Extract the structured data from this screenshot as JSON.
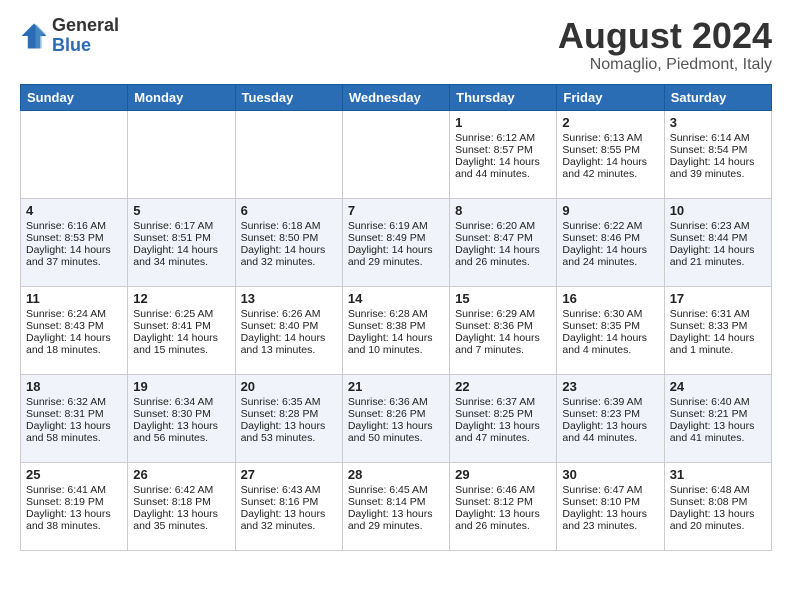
{
  "logo": {
    "general": "General",
    "blue": "Blue"
  },
  "title": "August 2024",
  "subtitle": "Nomaglio, Piedmont, Italy",
  "days": [
    "Sunday",
    "Monday",
    "Tuesday",
    "Wednesday",
    "Thursday",
    "Friday",
    "Saturday"
  ],
  "weeks": [
    [
      {
        "num": "",
        "sunrise": "",
        "sunset": "",
        "daylight": ""
      },
      {
        "num": "",
        "sunrise": "",
        "sunset": "",
        "daylight": ""
      },
      {
        "num": "",
        "sunrise": "",
        "sunset": "",
        "daylight": ""
      },
      {
        "num": "",
        "sunrise": "",
        "sunset": "",
        "daylight": ""
      },
      {
        "num": "1",
        "sunrise": "Sunrise: 6:12 AM",
        "sunset": "Sunset: 8:57 PM",
        "daylight": "Daylight: 14 hours and 44 minutes."
      },
      {
        "num": "2",
        "sunrise": "Sunrise: 6:13 AM",
        "sunset": "Sunset: 8:55 PM",
        "daylight": "Daylight: 14 hours and 42 minutes."
      },
      {
        "num": "3",
        "sunrise": "Sunrise: 6:14 AM",
        "sunset": "Sunset: 8:54 PM",
        "daylight": "Daylight: 14 hours and 39 minutes."
      }
    ],
    [
      {
        "num": "4",
        "sunrise": "Sunrise: 6:16 AM",
        "sunset": "Sunset: 8:53 PM",
        "daylight": "Daylight: 14 hours and 37 minutes."
      },
      {
        "num": "5",
        "sunrise": "Sunrise: 6:17 AM",
        "sunset": "Sunset: 8:51 PM",
        "daylight": "Daylight: 14 hours and 34 minutes."
      },
      {
        "num": "6",
        "sunrise": "Sunrise: 6:18 AM",
        "sunset": "Sunset: 8:50 PM",
        "daylight": "Daylight: 14 hours and 32 minutes."
      },
      {
        "num": "7",
        "sunrise": "Sunrise: 6:19 AM",
        "sunset": "Sunset: 8:49 PM",
        "daylight": "Daylight: 14 hours and 29 minutes."
      },
      {
        "num": "8",
        "sunrise": "Sunrise: 6:20 AM",
        "sunset": "Sunset: 8:47 PM",
        "daylight": "Daylight: 14 hours and 26 minutes."
      },
      {
        "num": "9",
        "sunrise": "Sunrise: 6:22 AM",
        "sunset": "Sunset: 8:46 PM",
        "daylight": "Daylight: 14 hours and 24 minutes."
      },
      {
        "num": "10",
        "sunrise": "Sunrise: 6:23 AM",
        "sunset": "Sunset: 8:44 PM",
        "daylight": "Daylight: 14 hours and 21 minutes."
      }
    ],
    [
      {
        "num": "11",
        "sunrise": "Sunrise: 6:24 AM",
        "sunset": "Sunset: 8:43 PM",
        "daylight": "Daylight: 14 hours and 18 minutes."
      },
      {
        "num": "12",
        "sunrise": "Sunrise: 6:25 AM",
        "sunset": "Sunset: 8:41 PM",
        "daylight": "Daylight: 14 hours and 15 minutes."
      },
      {
        "num": "13",
        "sunrise": "Sunrise: 6:26 AM",
        "sunset": "Sunset: 8:40 PM",
        "daylight": "Daylight: 14 hours and 13 minutes."
      },
      {
        "num": "14",
        "sunrise": "Sunrise: 6:28 AM",
        "sunset": "Sunset: 8:38 PM",
        "daylight": "Daylight: 14 hours and 10 minutes."
      },
      {
        "num": "15",
        "sunrise": "Sunrise: 6:29 AM",
        "sunset": "Sunset: 8:36 PM",
        "daylight": "Daylight: 14 hours and 7 minutes."
      },
      {
        "num": "16",
        "sunrise": "Sunrise: 6:30 AM",
        "sunset": "Sunset: 8:35 PM",
        "daylight": "Daylight: 14 hours and 4 minutes."
      },
      {
        "num": "17",
        "sunrise": "Sunrise: 6:31 AM",
        "sunset": "Sunset: 8:33 PM",
        "daylight": "Daylight: 14 hours and 1 minute."
      }
    ],
    [
      {
        "num": "18",
        "sunrise": "Sunrise: 6:32 AM",
        "sunset": "Sunset: 8:31 PM",
        "daylight": "Daylight: 13 hours and 58 minutes."
      },
      {
        "num": "19",
        "sunrise": "Sunrise: 6:34 AM",
        "sunset": "Sunset: 8:30 PM",
        "daylight": "Daylight: 13 hours and 56 minutes."
      },
      {
        "num": "20",
        "sunrise": "Sunrise: 6:35 AM",
        "sunset": "Sunset: 8:28 PM",
        "daylight": "Daylight: 13 hours and 53 minutes."
      },
      {
        "num": "21",
        "sunrise": "Sunrise: 6:36 AM",
        "sunset": "Sunset: 8:26 PM",
        "daylight": "Daylight: 13 hours and 50 minutes."
      },
      {
        "num": "22",
        "sunrise": "Sunrise: 6:37 AM",
        "sunset": "Sunset: 8:25 PM",
        "daylight": "Daylight: 13 hours and 47 minutes."
      },
      {
        "num": "23",
        "sunrise": "Sunrise: 6:39 AM",
        "sunset": "Sunset: 8:23 PM",
        "daylight": "Daylight: 13 hours and 44 minutes."
      },
      {
        "num": "24",
        "sunrise": "Sunrise: 6:40 AM",
        "sunset": "Sunset: 8:21 PM",
        "daylight": "Daylight: 13 hours and 41 minutes."
      }
    ],
    [
      {
        "num": "25",
        "sunrise": "Sunrise: 6:41 AM",
        "sunset": "Sunset: 8:19 PM",
        "daylight": "Daylight: 13 hours and 38 minutes."
      },
      {
        "num": "26",
        "sunrise": "Sunrise: 6:42 AM",
        "sunset": "Sunset: 8:18 PM",
        "daylight": "Daylight: 13 hours and 35 minutes."
      },
      {
        "num": "27",
        "sunrise": "Sunrise: 6:43 AM",
        "sunset": "Sunset: 8:16 PM",
        "daylight": "Daylight: 13 hours and 32 minutes."
      },
      {
        "num": "28",
        "sunrise": "Sunrise: 6:45 AM",
        "sunset": "Sunset: 8:14 PM",
        "daylight": "Daylight: 13 hours and 29 minutes."
      },
      {
        "num": "29",
        "sunrise": "Sunrise: 6:46 AM",
        "sunset": "Sunset: 8:12 PM",
        "daylight": "Daylight: 13 hours and 26 minutes."
      },
      {
        "num": "30",
        "sunrise": "Sunrise: 6:47 AM",
        "sunset": "Sunset: 8:10 PM",
        "daylight": "Daylight: 13 hours and 23 minutes."
      },
      {
        "num": "31",
        "sunrise": "Sunrise: 6:48 AM",
        "sunset": "Sunset: 8:08 PM",
        "daylight": "Daylight: 13 hours and 20 minutes."
      }
    ]
  ]
}
